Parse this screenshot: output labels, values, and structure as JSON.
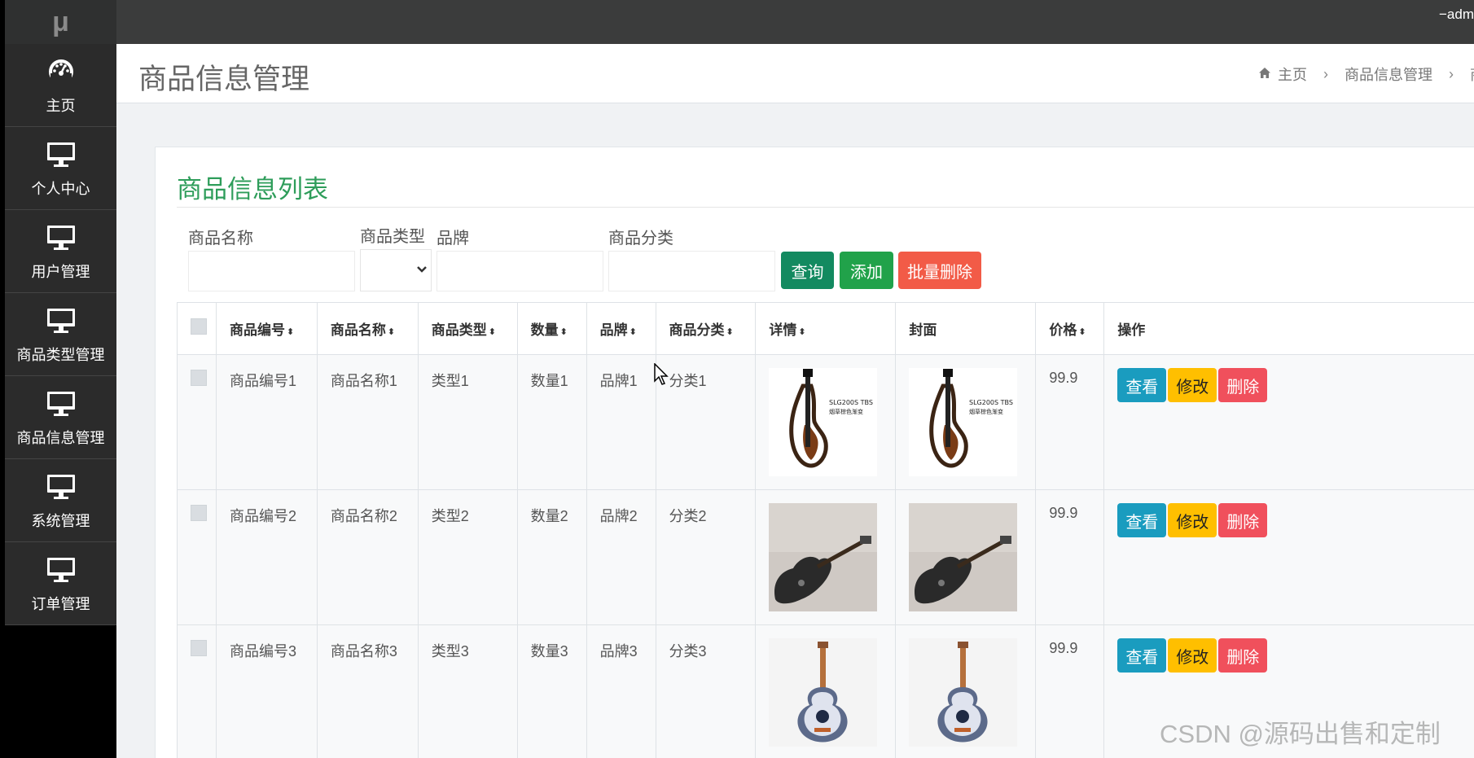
{
  "logo": {
    "text": "μ"
  },
  "sidebar": {
    "items": [
      {
        "label": "主页",
        "icon": "dashboard-icon"
      },
      {
        "label": "个人中心",
        "icon": "monitor-icon"
      },
      {
        "label": "用户管理",
        "icon": "monitor-icon"
      },
      {
        "label": "商品类型管理",
        "icon": "monitor-icon"
      },
      {
        "label": "商品信息管理",
        "icon": "monitor-icon"
      },
      {
        "label": "系统管理",
        "icon": "monitor-icon"
      },
      {
        "label": "订单管理",
        "icon": "monitor-icon"
      }
    ]
  },
  "topbar": {
    "user_text": "−adm"
  },
  "header": {
    "title": "商品信息管理",
    "breadcrumb": {
      "home": "主页",
      "current": "商品信息管理",
      "last": "商"
    }
  },
  "panel": {
    "title": "商品信息列表"
  },
  "filters": {
    "name_label": "商品名称",
    "type_label": "商品类型",
    "brand_label": "品牌",
    "category_label": "商品分类"
  },
  "buttons": {
    "query": "查询",
    "add": "添加",
    "batch_delete": "批量删除"
  },
  "table": {
    "headers": {
      "code": "商品编号",
      "name": "商品名称",
      "type": "商品类型",
      "qty": "数量",
      "brand": "品牌",
      "category": "商品分类",
      "detail": "详情",
      "cover": "封面",
      "price": "价格",
      "ops": "操作"
    },
    "sort_glyph": "⬍",
    "rows": [
      {
        "code": "商品编号1",
        "name": "商品名称1",
        "type": "类型1",
        "qty": "数量1",
        "brand": "品牌1",
        "category": "分类1",
        "price": "99.9",
        "image": "silent-guitar",
        "view": "查看",
        "edit": "修改",
        "delete": "删除"
      },
      {
        "code": "商品编号2",
        "name": "商品名称2",
        "type": "类型2",
        "qty": "数量2",
        "brand": "品牌2",
        "category": "分类2",
        "price": "99.9",
        "image": "electric-guitar",
        "view": "查看",
        "edit": "修改",
        "delete": "删除"
      },
      {
        "code": "商品编号3",
        "name": "商品名称3",
        "type": "类型3",
        "qty": "数量3",
        "brand": "品牌3",
        "category": "分类3",
        "price": "99.9",
        "image": "patterned-guitar",
        "view": "查看",
        "edit": "修改",
        "delete": "删除"
      }
    ]
  },
  "thumb_text": {
    "model": "SLG200S TBS",
    "sub": "烟草棕色渐变"
  },
  "colors": {
    "query": "#138a60",
    "add": "#21a24a",
    "batch_delete": "#f25b47",
    "view": "#1a9cbf",
    "edit": "#ffbf00",
    "delete": "#f0505c"
  },
  "watermark": "CSDN @源码出售和定制"
}
